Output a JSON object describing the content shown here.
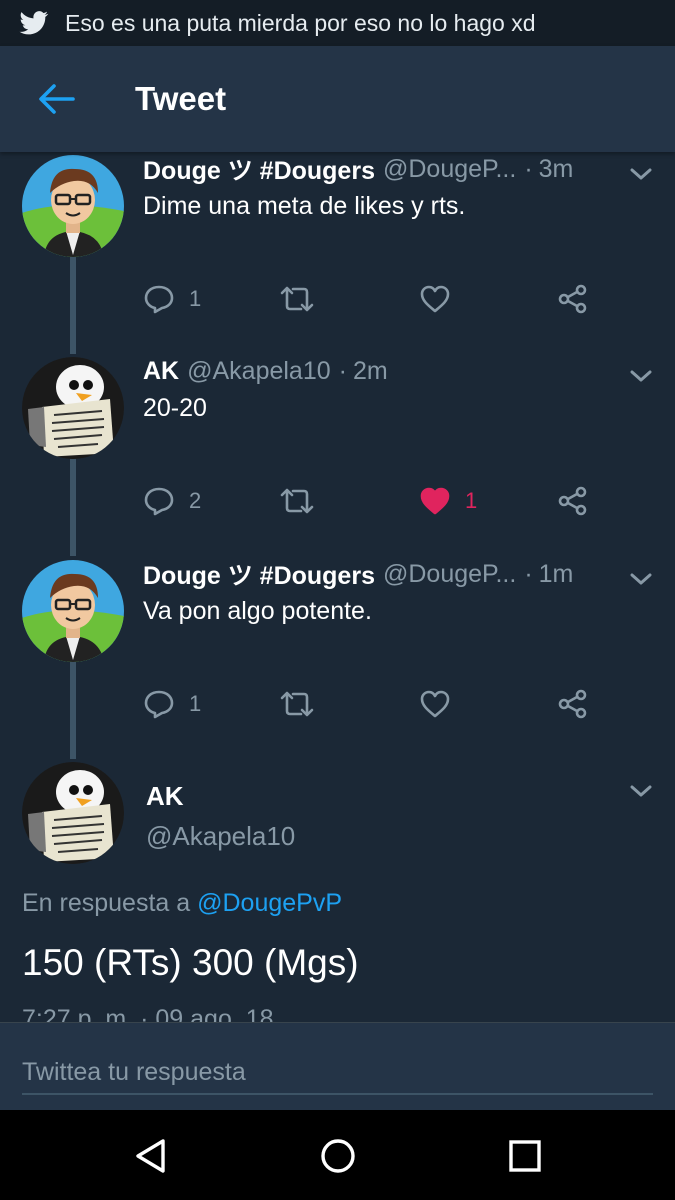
{
  "status_bar": {
    "notification_text": "Eso es una puta mierda por eso no lo hago xd"
  },
  "app_bar": {
    "title": "Tweet"
  },
  "thread": [
    {
      "name": "Douge ツ #Dougers",
      "handle": "@DougeP...",
      "time": "3m",
      "text": "Dime una meta de likes y rts.",
      "avatar": "cartoon-boy-avatar",
      "replies": "1",
      "retweets": "",
      "likes": "",
      "liked": false
    },
    {
      "name": "AK",
      "handle": "@Akapela10",
      "time": "2m",
      "text": "20-20",
      "avatar": "gunter-penguin-avatar",
      "replies": "2",
      "retweets": "",
      "likes": "1",
      "liked": true
    },
    {
      "name": "Douge ツ #Dougers",
      "handle": "@DougeP...",
      "time": "1m",
      "text": "Va pon algo potente.",
      "avatar": "cartoon-boy-avatar",
      "replies": "1",
      "retweets": "",
      "likes": "",
      "liked": false
    }
  ],
  "main_tweet": {
    "name": "AK",
    "handle": "@Akapela10",
    "reply_prefix": "En respuesta a",
    "reply_mention": "@DougePvP",
    "text": "150 (RTs) 300 (Mgs)",
    "date": "7:27 p. m. · 09 ago. 18"
  },
  "reply_bar": {
    "placeholder": "Twittea tu respuesta"
  },
  "colors": {
    "background": "#1b2836",
    "app_bar": "#243447",
    "status_bar": "#141d26",
    "secondary_text": "#8899a6",
    "accent": "#1da1f2",
    "like": "#e0245e"
  },
  "icons": {
    "status": "twitter-bird-icon",
    "back": "back-arrow-icon",
    "reply": "reply-icon",
    "retweet": "retweet-icon",
    "like": "heart-icon",
    "share": "share-icon",
    "caret": "chevron-down-icon",
    "nav_back": "nav-back-icon",
    "nav_home": "nav-home-icon",
    "nav_recents": "nav-recents-icon"
  }
}
